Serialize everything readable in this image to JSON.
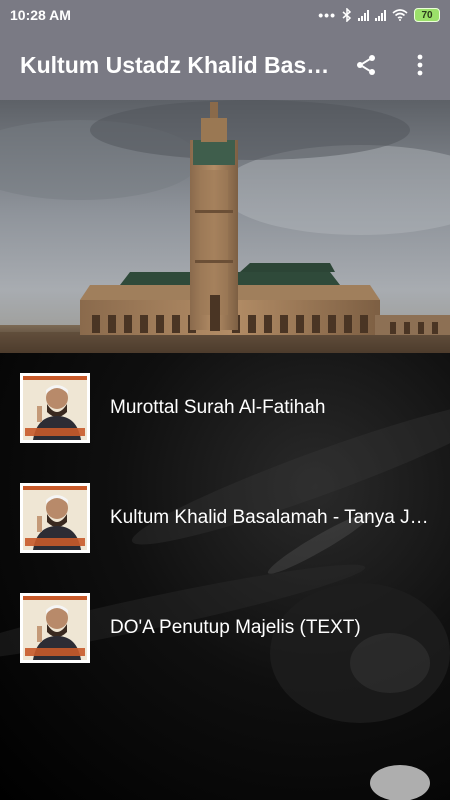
{
  "status_bar": {
    "time": "10:28 AM",
    "battery": "70",
    "icons": [
      "more-dots-icon",
      "bluetooth-icon",
      "signal-icon",
      "signal-icon",
      "wifi-icon",
      "battery-icon"
    ]
  },
  "app_bar": {
    "title": "Kultum Ustadz Khalid Basalamah",
    "actions": [
      "share-icon",
      "more-vert-icon"
    ],
    "background": "#7a7a84"
  },
  "banner": {
    "icon": "mosque-photo"
  },
  "list": {
    "items": [
      {
        "label": "Murottal Surah Al-Fatihah",
        "thumb_icon": "ustadz-thumbnail"
      },
      {
        "label": "Kultum Khalid Basalamah - Tanya Jawab",
        "thumb_icon": "ustadz-thumbnail"
      },
      {
        "label": "DO'A Penutup Majelis (TEXT)",
        "thumb_icon": "ustadz-thumbnail"
      }
    ]
  }
}
